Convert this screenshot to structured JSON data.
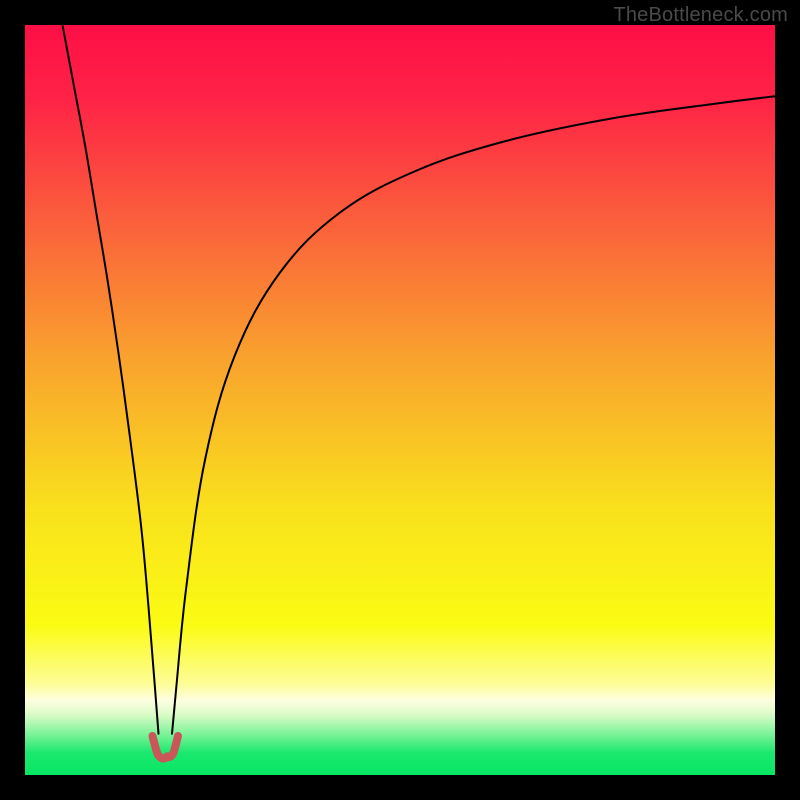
{
  "watermark": "TheBottleneck.com",
  "chart_data": {
    "type": "line",
    "title": "",
    "xlabel": "",
    "ylabel": "",
    "xlim": [
      0,
      100
    ],
    "ylim": [
      0,
      100
    ],
    "grid": false,
    "background_gradient": {
      "stops": [
        {
          "pos": 0.0,
          "color": "#fe0f46"
        },
        {
          "pos": 0.1,
          "color": "#fe2346"
        },
        {
          "pos": 0.25,
          "color": "#fb5b3c"
        },
        {
          "pos": 0.45,
          "color": "#f9a42d"
        },
        {
          "pos": 0.65,
          "color": "#f9e21c"
        },
        {
          "pos": 0.8,
          "color": "#fbfb13"
        },
        {
          "pos": 0.88,
          "color": "#fdfd9a"
        },
        {
          "pos": 0.9,
          "color": "#fefee1"
        },
        {
          "pos": 0.92,
          "color": "#d9fbc6"
        },
        {
          "pos": 0.95,
          "color": "#6bf190"
        },
        {
          "pos": 0.97,
          "color": "#1be86e"
        },
        {
          "pos": 1.0,
          "color": "#06e663"
        }
      ]
    },
    "series": [
      {
        "name": "left-branch",
        "x": [
          5.0,
          6.5,
          8.0,
          9.5,
          11.0,
          12.5,
          14.0,
          15.5,
          16.5,
          17.3,
          17.8
        ],
        "y": [
          100,
          92,
          84,
          75,
          66,
          56,
          45,
          33,
          22,
          12,
          5.5
        ],
        "stroke": "#000000",
        "width": 2
      },
      {
        "name": "right-branch",
        "x": [
          19.6,
          20.2,
          21.5,
          24.0,
          28.0,
          34.0,
          42.0,
          52.0,
          64.0,
          78.0,
          92.0,
          100.0
        ],
        "y": [
          5.5,
          12,
          25,
          42,
          56,
          67,
          75,
          80.5,
          84.5,
          87.5,
          89.5,
          90.5
        ],
        "stroke": "#000000",
        "width": 2
      },
      {
        "name": "valley-marker",
        "x": [
          17.0,
          17.6,
          18.0,
          18.4,
          18.8,
          19.0,
          19.3,
          19.8,
          20.4
        ],
        "y": [
          5.2,
          3.0,
          2.4,
          2.2,
          2.3,
          2.5,
          2.4,
          3.0,
          5.2
        ],
        "stroke": "#c95659",
        "width": 8
      }
    ]
  }
}
